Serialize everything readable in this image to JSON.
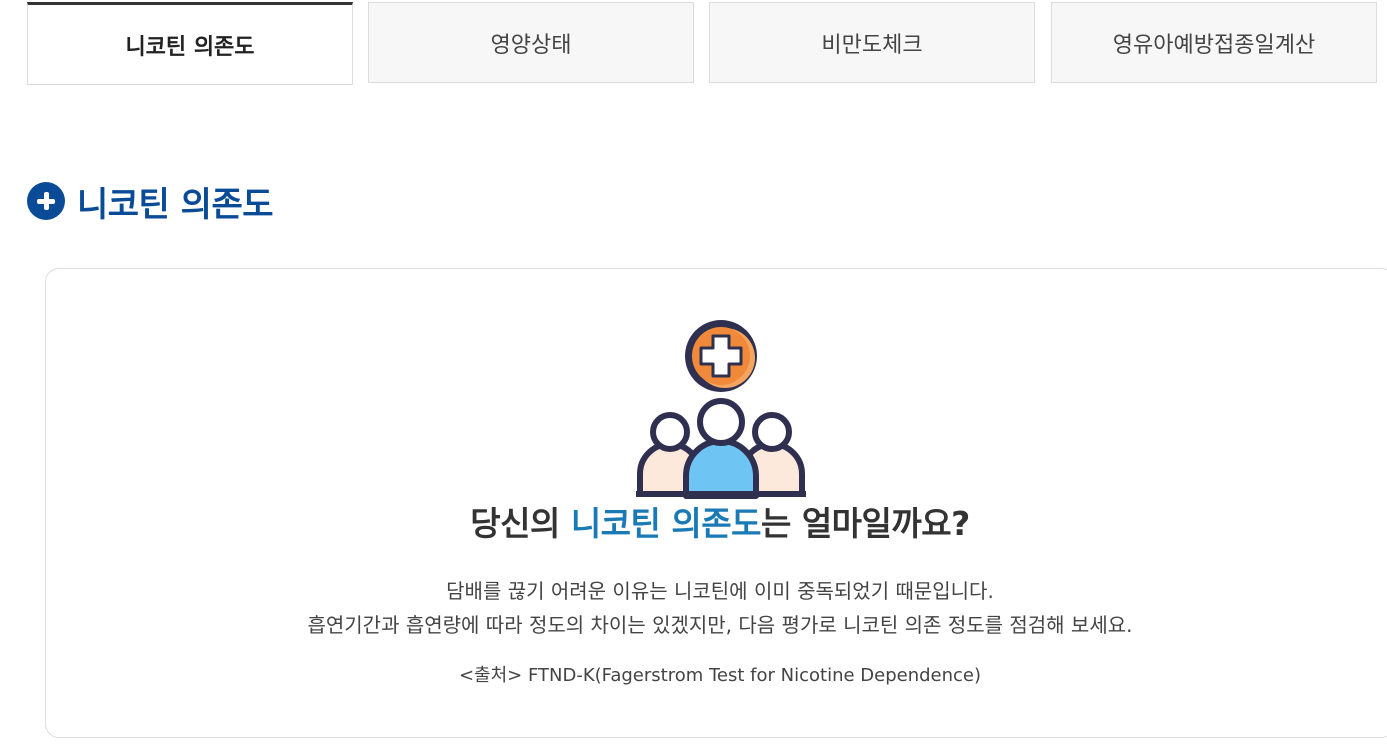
{
  "tabs": [
    {
      "label": "니코틴 의존도",
      "active": true
    },
    {
      "label": "영양상태",
      "active": false
    },
    {
      "label": "비만도체크",
      "active": false
    },
    {
      "label": "영유아예방접종일계산",
      "active": false
    }
  ],
  "section": {
    "title": "니코틴 의존도",
    "icon": "plus-circle-icon"
  },
  "card": {
    "illustration_icon": "people-medical-cross-icon",
    "headline_before": "당신의 ",
    "headline_highlight": "니코틴 의존도",
    "headline_after": "는 얼마일까요?",
    "description_line1": "담배를 끊기 어려운 이유는 니코틴에 이미 중독되었기 때문입니다.",
    "description_line2": "흡연기간과 흡연량에 따라 정도의 차이는 있겠지만, 다음 평가로 니코틴 의존 정도를 점검해 보세요.",
    "source": "<출처> FTND-K(Fagerstrom Test for Nicotine Dependence)"
  },
  "colors": {
    "brand_blue": "#0a4b98",
    "highlight_blue": "#1a7ab5",
    "accent_orange": "#f08a3a"
  }
}
